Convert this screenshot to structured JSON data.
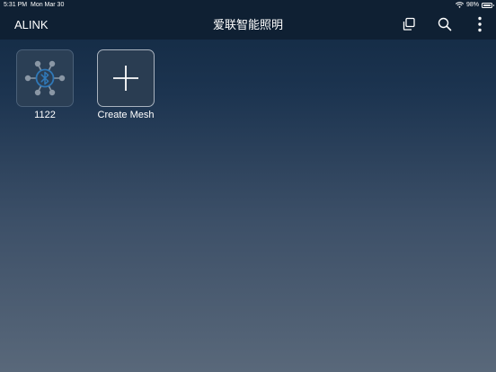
{
  "status_bar": {
    "time": "5:31 PM",
    "date": "Mon Mar 30",
    "battery": "98%",
    "battery_level": 0.98,
    "icons": [
      "wifi-icon",
      "battery-icon"
    ]
  },
  "header": {
    "brand": "ALINK",
    "title": "爱联智能照明",
    "icons": [
      "copy-icon",
      "search-icon",
      "more-vertical-icon"
    ]
  },
  "tiles": [
    {
      "label": "1122",
      "icon": "bluetooth-mesh-icon"
    },
    {
      "label": "Create Mesh",
      "icon": "plus-icon"
    }
  ],
  "colors": {
    "nav_background": "#0f2033",
    "background_top": "#112841",
    "background_bottom": "#59687a",
    "mesh_icon_node": "#8a97a5",
    "bluetooth_blue": "#2f78b8"
  }
}
